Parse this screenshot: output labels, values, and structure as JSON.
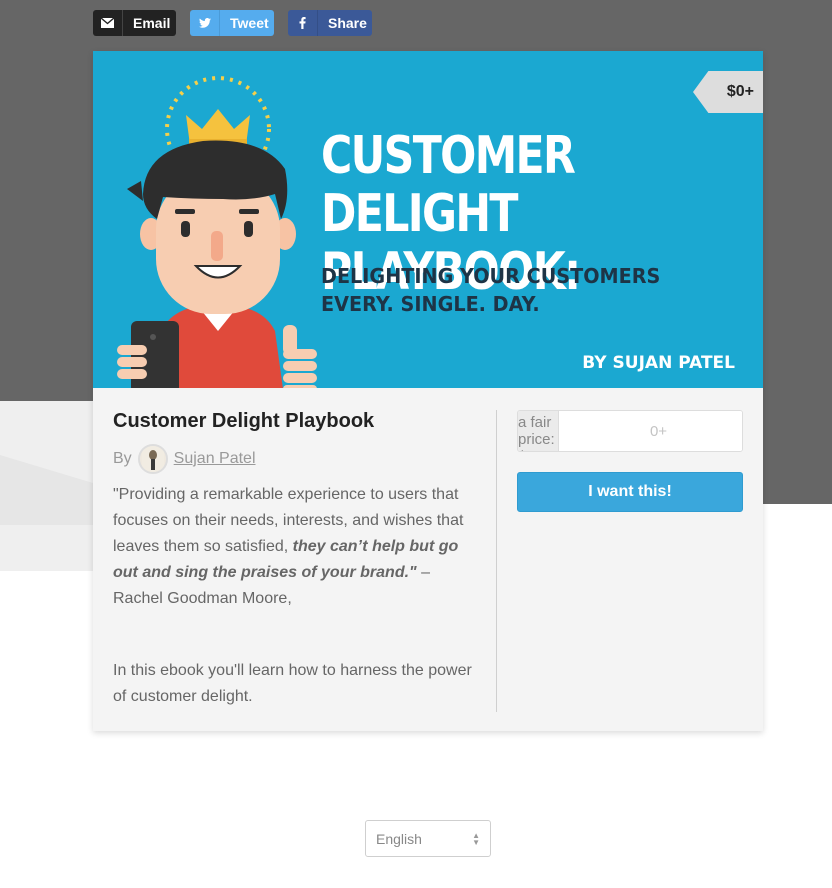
{
  "share": {
    "email_label": "Email",
    "tweet_label": "Tweet",
    "share_label": "Share"
  },
  "cover": {
    "title": "CUSTOMER DELIGHT\nPLAYBOOK:",
    "subtitle": "DELIGHTING YOUR CUSTOMERS\nEVERY. SINGLE. DAY.",
    "author": "BY SUJAN PATEL",
    "price_tag": "$0+"
  },
  "product": {
    "title": "Customer Delight Playbook",
    "by_label": "By",
    "author_name": "Sujan Patel",
    "quote_start": "\"Providing a remarkable experience to users that focuses on their needs, interests, and wishes that leaves them so satisfied, ",
    "quote_emphasis": "they can’t help but go out and sing the praises of your brand.\"",
    "quote_end": " – Rachel Goodman Moore,",
    "description": "In this ebook you'll learn how to harness the power of customer delight."
  },
  "purchase": {
    "price_label": "Name a fair price: $",
    "price_placeholder": "0+",
    "buy_label": "I want this!"
  },
  "language": {
    "selected": "English"
  },
  "colors": {
    "cover_bg": "#1ba8d1",
    "buy_button": "#3aa7dc",
    "email": "#222222",
    "tweet": "#55acee",
    "share": "#3b5998"
  }
}
